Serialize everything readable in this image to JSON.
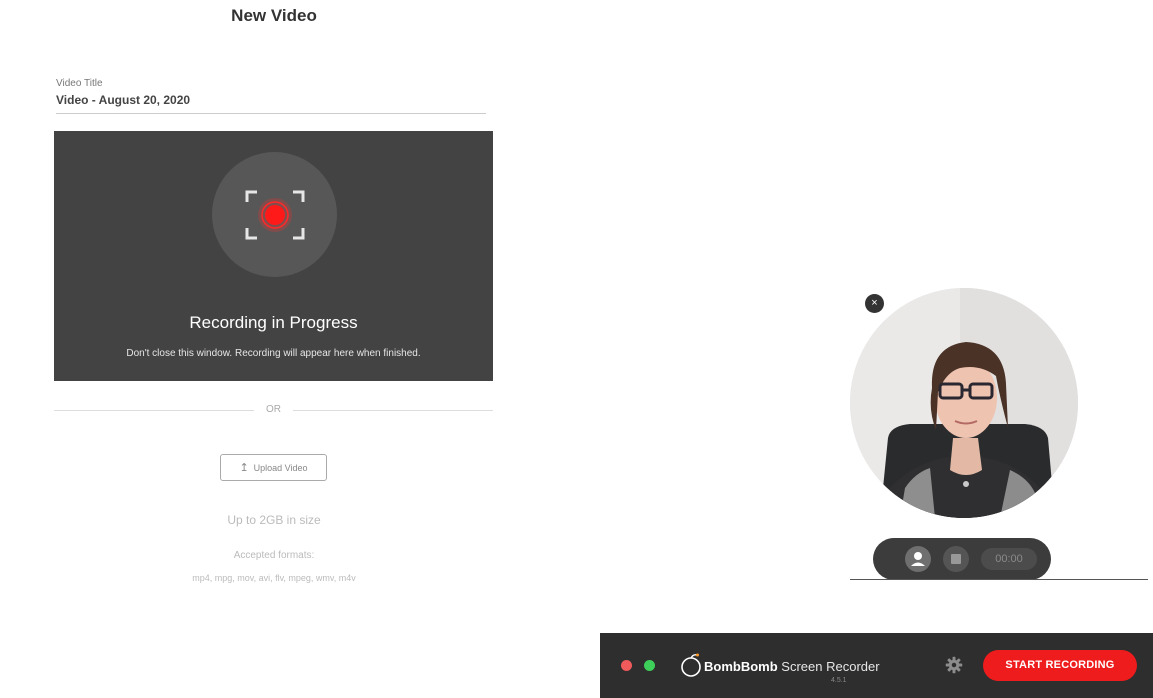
{
  "header": {
    "title": "New Video"
  },
  "video_title": {
    "label": "Video Title",
    "value": "Video - August 20, 2020"
  },
  "recording": {
    "heading": "Recording in Progress",
    "message": "Don't close this window. Recording will appear here when finished."
  },
  "divider": {
    "text": "OR"
  },
  "upload": {
    "button_label": "Upload Video",
    "size_note": "Up to 2GB in size",
    "formats_label": "Accepted formats:",
    "formats": "mp4, mpg, mov, avi, flv, mpeg, wmv, m4v"
  },
  "webcam": {
    "close_label": "×",
    "timer": "00:00"
  },
  "recorder": {
    "brand_bold": "BombBomb",
    "brand_regular": "Screen Recorder",
    "version": "4.5.1",
    "start_label": "START RECORDING",
    "accent_color": "#ee1c1c"
  },
  "icons": [
    "record-target-icon",
    "upload-arrow-icon",
    "close-icon",
    "person-icon",
    "stop-icon",
    "bombbomb-logo-icon",
    "gear-icon"
  ]
}
